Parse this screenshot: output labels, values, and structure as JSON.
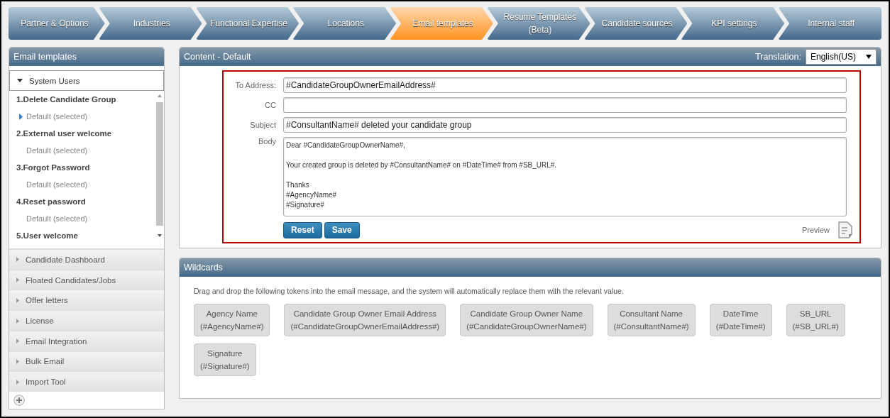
{
  "steps": [
    {
      "label": "Partner & Options",
      "selected": false
    },
    {
      "label": "Industries",
      "selected": false
    },
    {
      "label": "Functional Expertise",
      "selected": false
    },
    {
      "label": "Locations",
      "selected": false
    },
    {
      "label": "Email templates",
      "selected": true
    },
    {
      "label": "Resume Templates (Beta)",
      "selected": false
    },
    {
      "label": "Candidate sources",
      "selected": false
    },
    {
      "label": "KPI settings",
      "selected": false
    },
    {
      "label": "Internal staff",
      "selected": false
    }
  ],
  "sidebar": {
    "title": "Email templates",
    "sections": [
      {
        "label": "System Users",
        "expanded": true,
        "templates": [
          {
            "label": "1.Delete Candidate Group",
            "variants": [
              {
                "label": "Default (selected)",
                "selected": true
              }
            ]
          },
          {
            "label": "2.External user welcome",
            "variants": [
              {
                "label": "Default (selected)",
                "selected": false
              }
            ]
          },
          {
            "label": "3.Forgot Password",
            "variants": [
              {
                "label": "Default (selected)",
                "selected": false
              }
            ]
          },
          {
            "label": "4.Reset password",
            "variants": [
              {
                "label": "Default (selected)",
                "selected": false
              }
            ]
          },
          {
            "label": "5.User welcome"
          }
        ]
      },
      {
        "label": "Candidate Dashboard",
        "expanded": false
      },
      {
        "label": "Floated Candidates/Jobs",
        "expanded": false
      },
      {
        "label": "Offer letters",
        "expanded": false
      },
      {
        "label": "License",
        "expanded": false
      },
      {
        "label": "Email Integration",
        "expanded": false
      },
      {
        "label": "Bulk Email",
        "expanded": false
      },
      {
        "label": "Import Tool",
        "expanded": false
      }
    ]
  },
  "content": {
    "title": "Content - Default",
    "translation_label": "Translation:",
    "translation": "English(US)",
    "fields": [
      {
        "label": "To Address:",
        "value": "#CandidateGroupOwnerEmailAddress#"
      },
      {
        "label": "CC"
      },
      {
        "label": "Subject",
        "value": "#ConsultantName# deleted your candidate group"
      }
    ],
    "body_label": "Body",
    "body": [
      [
        "Dear #CandidateGroupOwnerName#,"
      ],
      [
        "Your created group is deleted by #ConsultantName# on #DateTime# from #SB_URL#."
      ],
      [
        "Thanks",
        "#AgencyName#",
        "#Signature#"
      ]
    ],
    "buttons": [
      "Reset",
      "Save"
    ],
    "preview": "Preview"
  },
  "wildcards": {
    "title": "Wildcards",
    "hint": "Drag and drop the following tokens into the email message, and the system will automatically replace them with the relevant value.",
    "tokens": [
      {
        "name": "Agency Name",
        "token": "(#AgencyName#)"
      },
      {
        "name": "Candidate Group Owner Email Address",
        "token": "(#CandidateGroupOwnerEmailAddress#)"
      },
      {
        "name": "Candidate Group Owner Name",
        "token": "(#CandidateGroupOwnerName#)"
      },
      {
        "name": "Consultant Name",
        "token": "(#ConsultantName#)"
      },
      {
        "name": "DateTime",
        "token": "(#DateTime#)"
      },
      {
        "name": "SB_URL",
        "token": "(#SB_URL#)"
      },
      {
        "name": "Signature",
        "token": "(#Signature#)"
      }
    ]
  }
}
